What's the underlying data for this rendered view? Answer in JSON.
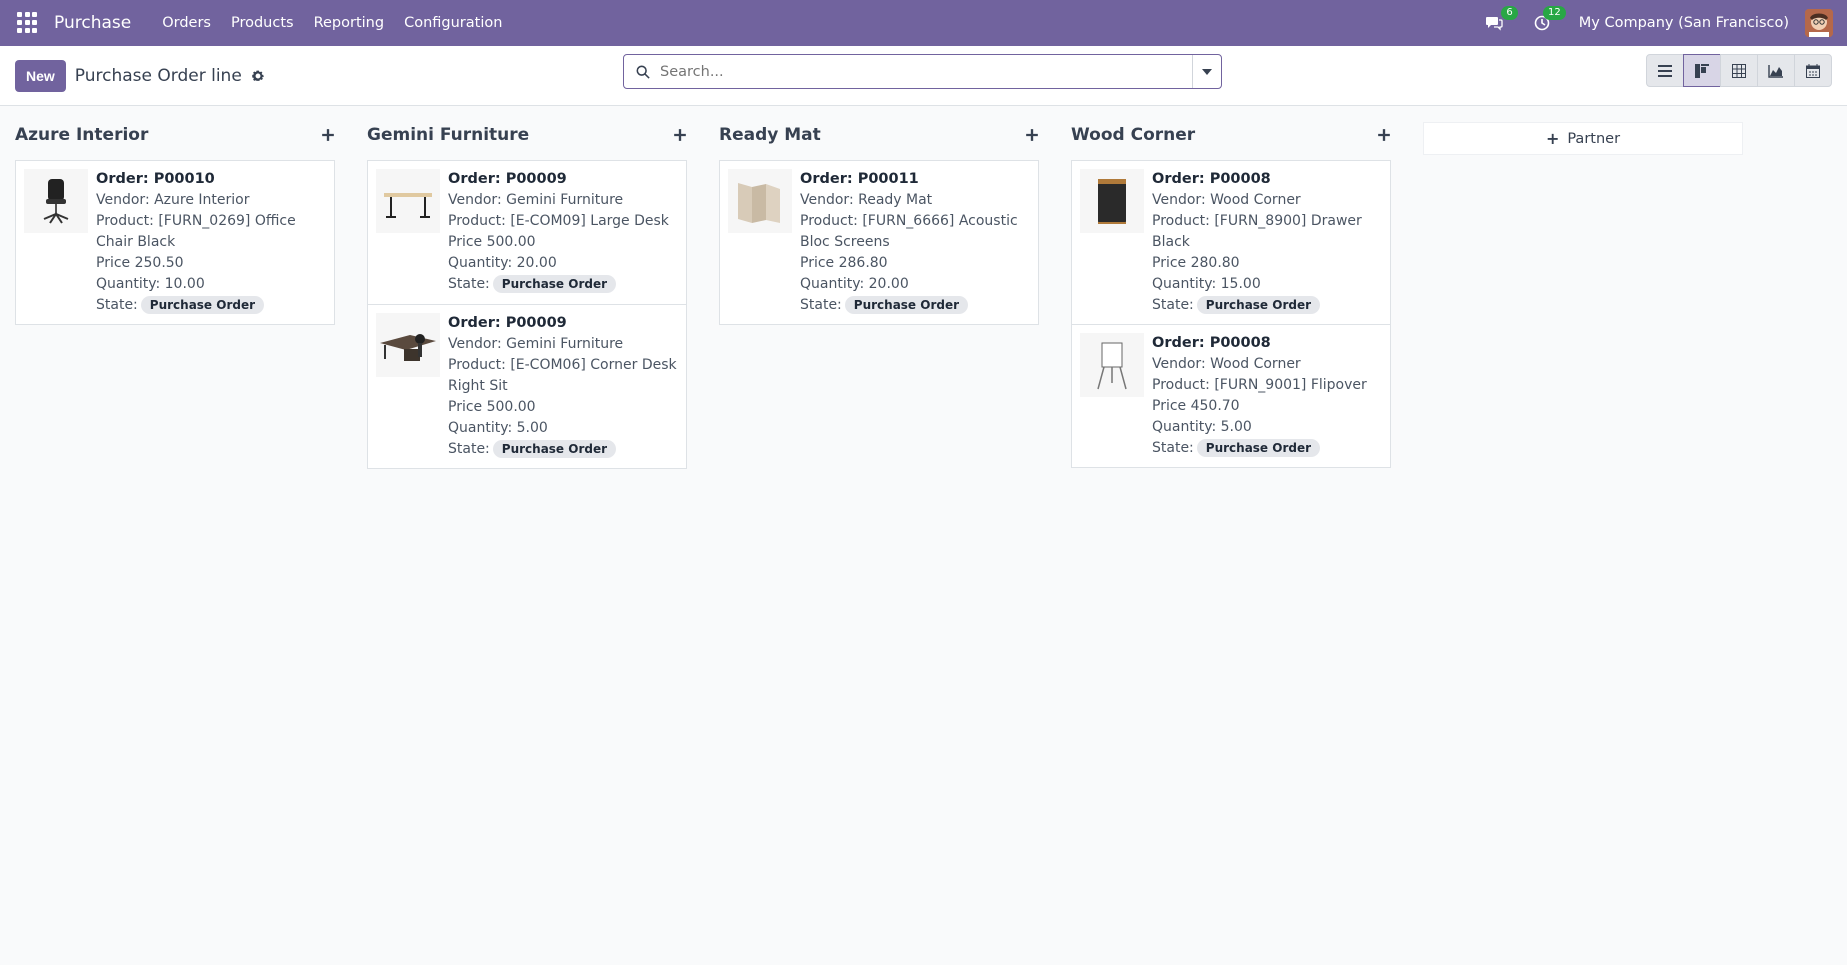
{
  "navbar": {
    "app_title": "Purchase",
    "menu": [
      "Orders",
      "Products",
      "Reporting",
      "Configuration"
    ],
    "messages_count": "6",
    "activities_count": "12",
    "company": "My Company (San Francisco)"
  },
  "control_panel": {
    "new_label": "New",
    "title": "Purchase Order line",
    "search_placeholder": "Search..."
  },
  "kanban": {
    "columns": [
      {
        "title": "Azure Interior",
        "cards": [
          {
            "order": "Order: P00010",
            "vendor": "Vendor: Azure Interior",
            "product": "Product: [FURN_0269] Office Chair Black",
            "price": "Price 250.50",
            "quantity": "Quantity: 10.00",
            "state_label": "State:",
            "state": "Purchase Order",
            "image": "office-chair"
          }
        ]
      },
      {
        "title": "Gemini Furniture",
        "cards": [
          {
            "order": "Order: P00009",
            "vendor": "Vendor: Gemini Furniture",
            "product": "Product: [E-COM09] Large Desk",
            "price": "Price 500.00",
            "quantity": "Quantity: 20.00",
            "state_label": "State:",
            "state": "Purchase Order",
            "image": "large-desk"
          },
          {
            "order": "Order: P00009",
            "vendor": "Vendor: Gemini Furniture",
            "product": "Product: [E-COM06] Corner Desk Right Sit",
            "price": "Price 500.00",
            "quantity": "Quantity: 5.00",
            "state_label": "State:",
            "state": "Purchase Order",
            "image": "corner-desk"
          }
        ]
      },
      {
        "title": "Ready Mat",
        "cards": [
          {
            "order": "Order: P00011",
            "vendor": "Vendor: Ready Mat",
            "product": "Product: [FURN_6666] Acoustic Bloc Screens",
            "price": "Price 286.80",
            "quantity": "Quantity: 20.00",
            "state_label": "State:",
            "state": "Purchase Order",
            "image": "acoustic-screens"
          }
        ]
      },
      {
        "title": "Wood Corner",
        "cards": [
          {
            "order": "Order: P00008",
            "vendor": "Vendor: Wood Corner",
            "product": "Product: [FURN_8900] Drawer Black",
            "price": "Price 280.80",
            "quantity": "Quantity: 15.00",
            "state_label": "State:",
            "state": "Purchase Order",
            "image": "drawer-black"
          },
          {
            "order": "Order: P00008",
            "vendor": "Vendor: Wood Corner",
            "product": "Product: [FURN_9001] Flipover",
            "price": "Price 450.70",
            "quantity": "Quantity: 5.00",
            "state_label": "State:",
            "state": "Purchase Order",
            "image": "flipover"
          }
        ]
      }
    ],
    "add_column_label": "Partner"
  }
}
